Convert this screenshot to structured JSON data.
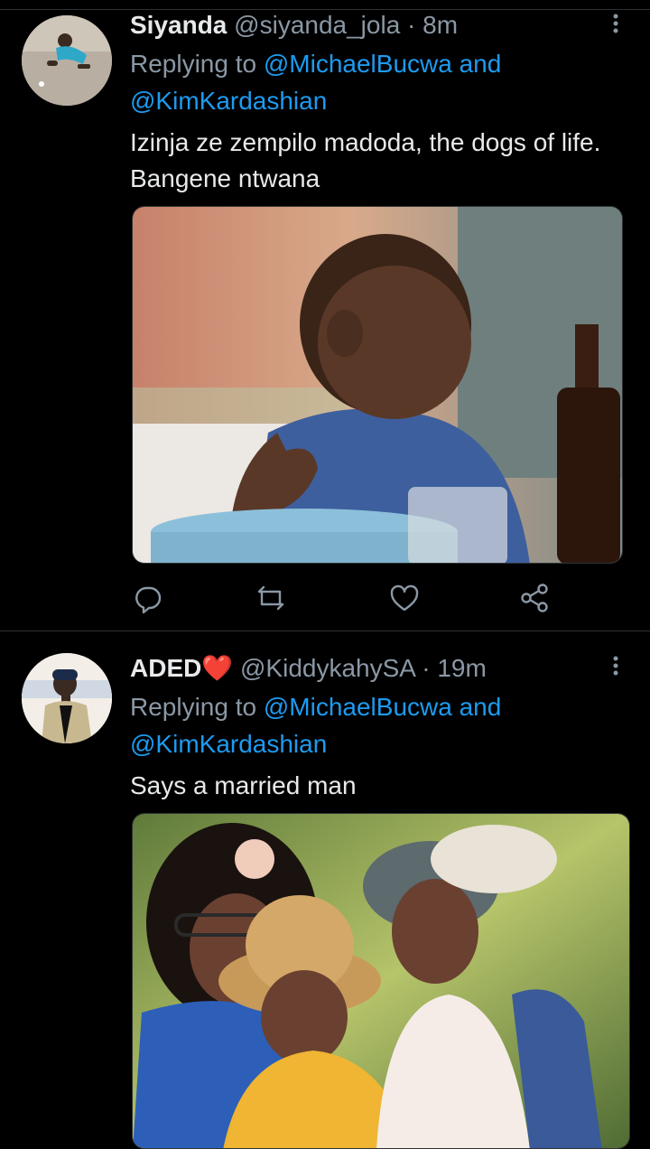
{
  "colors": {
    "background": "#000000",
    "text_primary": "#e7e9ea",
    "text_secondary": "#8b98a5",
    "link": "#1d9bf0",
    "divider": "#2f3336"
  },
  "tweets": [
    {
      "display_name": "Siyanda",
      "handle": "@siyanda_jola",
      "separator": "·",
      "time": "8m",
      "replying_prefix": "Replying to",
      "mention_1": "@MichaelBucwa",
      "and_word": "and",
      "mention_2": "@KimKardashian",
      "text": "Izinja ze zempilo madoda, the dogs of life. Bangene ntwana",
      "actions": [
        "reply-icon",
        "retweet-icon",
        "like-icon",
        "share-icon"
      ]
    },
    {
      "display_name": "ADED",
      "name_emoji": "❤️",
      "handle": "@KiddykahySA",
      "separator": "·",
      "time": "19m",
      "replying_prefix": "Replying to",
      "mention_1": "@MichaelBucwa",
      "and_word": "and",
      "mention_2": "@KimKardashian",
      "text": "Says a married man"
    }
  ]
}
